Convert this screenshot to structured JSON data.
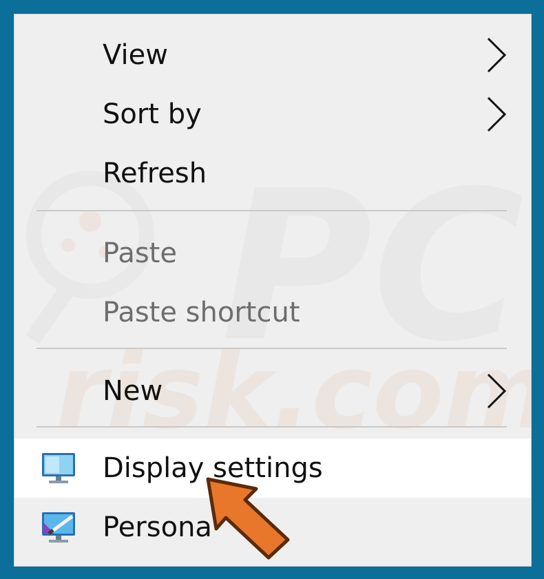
{
  "menu": {
    "items": [
      {
        "label": "View",
        "has_submenu": true,
        "enabled": true
      },
      {
        "label": "Sort by",
        "has_submenu": true,
        "enabled": true
      },
      {
        "label": "Refresh",
        "has_submenu": false,
        "enabled": true
      },
      {
        "label": "Paste",
        "has_submenu": false,
        "enabled": false
      },
      {
        "label": "Paste shortcut",
        "has_submenu": false,
        "enabled": false
      },
      {
        "label": "New",
        "has_submenu": true,
        "enabled": true
      },
      {
        "label": "Display settings",
        "has_submenu": false,
        "enabled": true,
        "icon": "display-settings-icon",
        "highlighted": true
      },
      {
        "label": "Persona",
        "has_submenu": false,
        "enabled": true,
        "icon": "personalize-icon"
      }
    ]
  },
  "colors": {
    "desktop_background": "#0b6f9a",
    "menu_background": "#efefef",
    "highlight": "#ffffff",
    "disabled_text": "#6d6d6d",
    "pointer_arrow": "#e8762b"
  },
  "watermark": {
    "text_top": "PC",
    "text_bottom": "risk.com"
  }
}
